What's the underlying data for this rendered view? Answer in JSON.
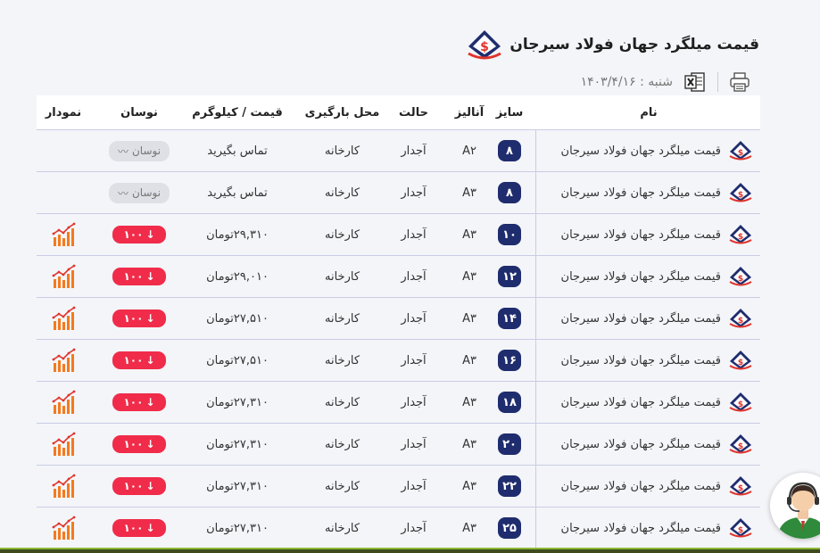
{
  "header": {
    "title": "قیمت میلگرد جهان فولاد سیرجان",
    "date_text": "شنبه : ۱۴۰۳/۴/۱۶"
  },
  "columns": {
    "name": "نام",
    "size": "سایز",
    "analysis": "آنالیز",
    "state": "حالت",
    "place": "محل بارگیری",
    "price": "قیمت / کیلوگرم",
    "fluctuation": "نوسان",
    "chart": "نمودار"
  },
  "rows": [
    {
      "name": "قیمت میلگرد جهان فولاد سیرجان",
      "size": "۸",
      "analysis": "A۲",
      "state": "آجدار",
      "place": "کارخانه",
      "price": "تماس بگیرید",
      "fluct": "نوسان",
      "fluct_type": "none",
      "show_chart": false
    },
    {
      "name": "قیمت میلگرد جهان فولاد سیرجان",
      "size": "۸",
      "analysis": "A۳",
      "state": "آجدار",
      "place": "کارخانه",
      "price": "تماس بگیرید",
      "fluct": "نوسان",
      "fluct_type": "none",
      "show_chart": false
    },
    {
      "name": "قیمت میلگرد جهان فولاد سیرجان",
      "size": "۱۰",
      "analysis": "A۳",
      "state": "آجدار",
      "place": "کارخانه",
      "price": "۲۹,۳۱۰تومان",
      "fluct": "۱۰۰",
      "fluct_type": "down",
      "show_chart": true
    },
    {
      "name": "قیمت میلگرد جهان فولاد سیرجان",
      "size": "۱۲",
      "analysis": "A۳",
      "state": "آجدار",
      "place": "کارخانه",
      "price": "۲۹,۰۱۰تومان",
      "fluct": "۱۰۰",
      "fluct_type": "down",
      "show_chart": true
    },
    {
      "name": "قیمت میلگرد جهان فولاد سیرجان",
      "size": "۱۴",
      "analysis": "A۳",
      "state": "آجدار",
      "place": "کارخانه",
      "price": "۲۷,۵۱۰تومان",
      "fluct": "۱۰۰",
      "fluct_type": "down",
      "show_chart": true
    },
    {
      "name": "قیمت میلگرد جهان فولاد سیرجان",
      "size": "۱۶",
      "analysis": "A۳",
      "state": "آجدار",
      "place": "کارخانه",
      "price": "۲۷,۵۱۰تومان",
      "fluct": "۱۰۰",
      "fluct_type": "down",
      "show_chart": true
    },
    {
      "name": "قیمت میلگرد جهان فولاد سیرجان",
      "size": "۱۸",
      "analysis": "A۳",
      "state": "آجدار",
      "place": "کارخانه",
      "price": "۲۷,۳۱۰تومان",
      "fluct": "۱۰۰",
      "fluct_type": "down",
      "show_chart": true
    },
    {
      "name": "قیمت میلگرد جهان فولاد سیرجان",
      "size": "۲۰",
      "analysis": "A۳",
      "state": "آجدار",
      "place": "کارخانه",
      "price": "۲۷,۳۱۰تومان",
      "fluct": "۱۰۰",
      "fluct_type": "down",
      "show_chart": true
    },
    {
      "name": "قیمت میلگرد جهان فولاد سیرجان",
      "size": "۲۲",
      "analysis": "A۳",
      "state": "آجدار",
      "place": "کارخانه",
      "price": "۲۷,۳۱۰تومان",
      "fluct": "۱۰۰",
      "fluct_type": "down",
      "show_chart": true
    },
    {
      "name": "قیمت میلگرد جهان فولاد سیرجان",
      "size": "۲۵",
      "analysis": "A۳",
      "state": "آجدار",
      "place": "کارخانه",
      "price": "۲۷,۳۱۰تومان",
      "fluct": "۱۰۰",
      "fluct_type": "down",
      "show_chart": true
    }
  ],
  "icons": {
    "logo": "company-logo-icon",
    "excel": "excel-icon",
    "print": "printer-icon",
    "chart": "bar-chart-icon",
    "wave": "wave-icon",
    "arrow_down": "arrow-down-icon",
    "support": "support-agent-icon"
  },
  "colors": {
    "badge": "#1f2d6e",
    "down": "#f02c4a",
    "neutral_pill": "#dfe0e6",
    "chart": "#f47a1f"
  }
}
